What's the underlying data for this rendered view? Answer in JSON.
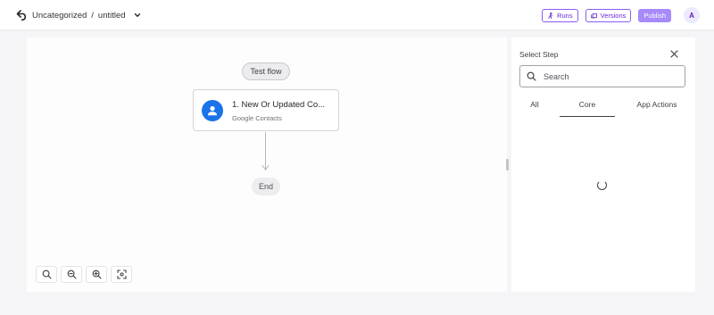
{
  "header": {
    "breadcrumb_folder": "Uncategorized",
    "breadcrumb_separator": "/",
    "flow_name": "untitled",
    "runs_label": "Runs",
    "versions_label": "Versions",
    "publish_label": "Publish",
    "avatar_initial": "A"
  },
  "canvas": {
    "test_flow_label": "Test flow",
    "step": {
      "title": "1. New Or Updated Co...",
      "subtitle": "Google Contacts",
      "icon": "person-icon"
    },
    "end_label": "End",
    "zoom_controls": [
      "zoom-fit-icon",
      "zoom-out-icon",
      "zoom-in-icon",
      "focus-icon"
    ]
  },
  "panel": {
    "title": "Select Step",
    "search_placeholder": "Search",
    "tabs": [
      {
        "label": "All",
        "active": false
      },
      {
        "label": "Core",
        "active": true
      },
      {
        "label": "App Actions",
        "active": false
      }
    ],
    "loading": true
  },
  "colors": {
    "accent": "#8b5cf6",
    "publish_bg": "#a78bfa",
    "step_icon_bg": "#1a73e8"
  }
}
